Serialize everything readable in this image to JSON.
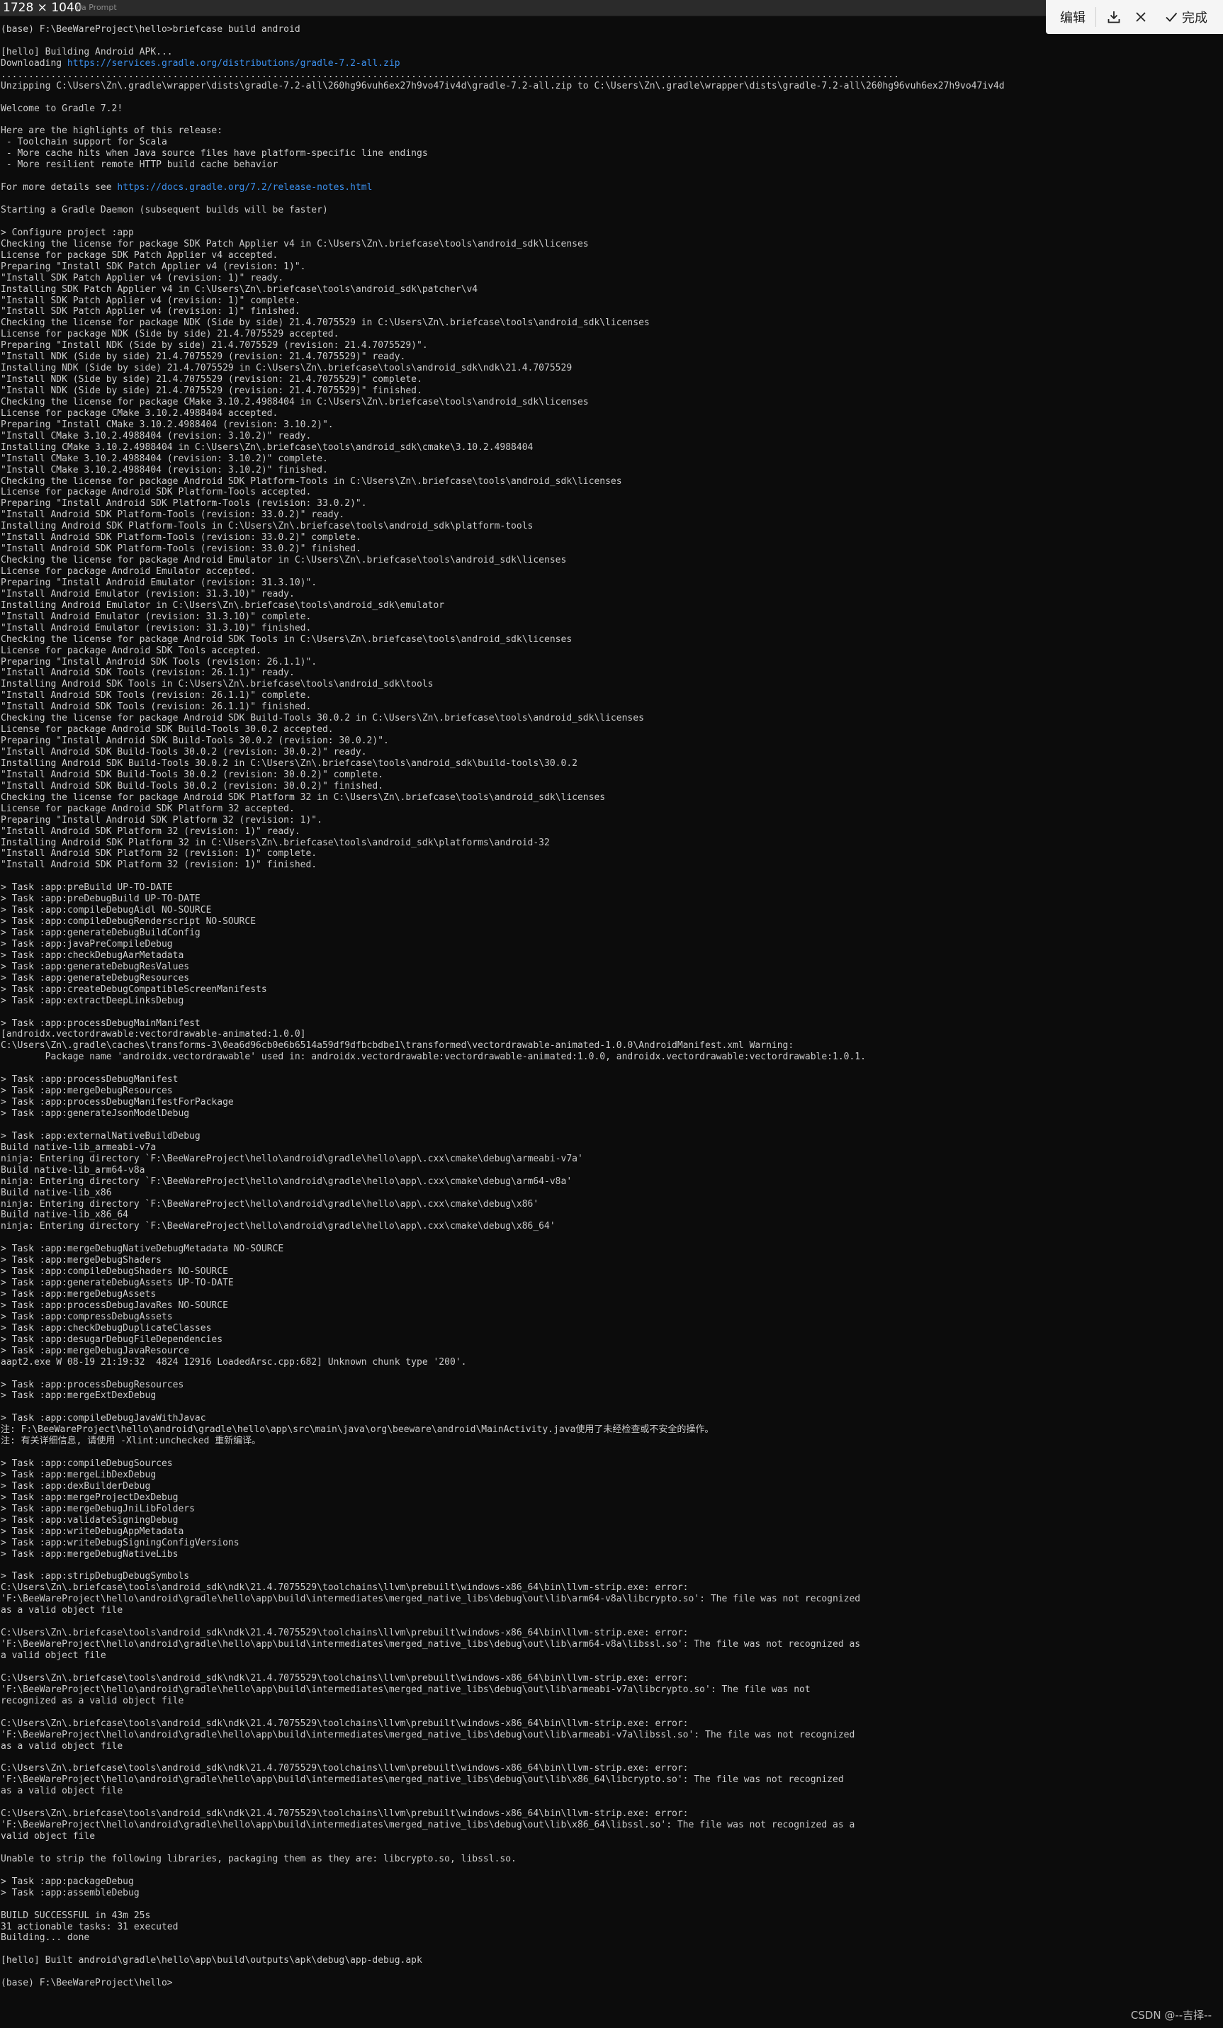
{
  "titlebar": {
    "dimensions": "1728 × 1040",
    "window_title": "da Prompt"
  },
  "toolbar": {
    "edit_label": "编辑",
    "done_label": "完成",
    "icons": [
      "download-icon",
      "close-icon",
      "check-icon"
    ]
  },
  "watermark": "CSDN @--吉择--",
  "colors": {
    "background": "#0c0c0c",
    "text": "#cccccc",
    "link": "#3b8eea"
  },
  "terminal": {
    "lines": [
      {
        "text": "(base) F:\\BeeWareProject\\hello>briefcase build android"
      },
      {
        "text": ""
      },
      {
        "text": "[hello] Building Android APK..."
      },
      {
        "text": "Downloading ",
        "link": "https://services.gradle.org/distributions/gradle-7.2-all.zip"
      },
      {
        "text": ".................................................................................................................................................................."
      },
      {
        "text": "Unzipping C:\\Users\\Zn\\.gradle\\wrapper\\dists\\gradle-7.2-all\\260hg96vuh6ex27h9vo47iv4d\\gradle-7.2-all.zip to C:\\Users\\Zn\\.gradle\\wrapper\\dists\\gradle-7.2-all\\260hg96vuh6ex27h9vo47iv4d"
      },
      {
        "text": ""
      },
      {
        "text": "Welcome to Gradle 7.2!"
      },
      {
        "text": ""
      },
      {
        "text": "Here are the highlights of this release:"
      },
      {
        "text": " - Toolchain support for Scala"
      },
      {
        "text": " - More cache hits when Java source files have platform-specific line endings"
      },
      {
        "text": " - More resilient remote HTTP build cache behavior"
      },
      {
        "text": ""
      },
      {
        "text": "For more details see ",
        "link": "https://docs.gradle.org/7.2/release-notes.html"
      },
      {
        "text": ""
      },
      {
        "text": "Starting a Gradle Daemon (subsequent builds will be faster)"
      },
      {
        "text": ""
      },
      {
        "text": "> Configure project :app"
      },
      {
        "text": "Checking the license for package SDK Patch Applier v4 in C:\\Users\\Zn\\.briefcase\\tools\\android_sdk\\licenses"
      },
      {
        "text": "License for package SDK Patch Applier v4 accepted."
      },
      {
        "text": "Preparing \"Install SDK Patch Applier v4 (revision: 1)\"."
      },
      {
        "text": "\"Install SDK Patch Applier v4 (revision: 1)\" ready."
      },
      {
        "text": "Installing SDK Patch Applier v4 in C:\\Users\\Zn\\.briefcase\\tools\\android_sdk\\patcher\\v4"
      },
      {
        "text": "\"Install SDK Patch Applier v4 (revision: 1)\" complete."
      },
      {
        "text": "\"Install SDK Patch Applier v4 (revision: 1)\" finished."
      },
      {
        "text": "Checking the license for package NDK (Side by side) 21.4.7075529 in C:\\Users\\Zn\\.briefcase\\tools\\android_sdk\\licenses"
      },
      {
        "text": "License for package NDK (Side by side) 21.4.7075529 accepted."
      },
      {
        "text": "Preparing \"Install NDK (Side by side) 21.4.7075529 (revision: 21.4.7075529)\"."
      },
      {
        "text": "\"Install NDK (Side by side) 21.4.7075529 (revision: 21.4.7075529)\" ready."
      },
      {
        "text": "Installing NDK (Side by side) 21.4.7075529 in C:\\Users\\Zn\\.briefcase\\tools\\android_sdk\\ndk\\21.4.7075529"
      },
      {
        "text": "\"Install NDK (Side by side) 21.4.7075529 (revision: 21.4.7075529)\" complete."
      },
      {
        "text": "\"Install NDK (Side by side) 21.4.7075529 (revision: 21.4.7075529)\" finished."
      },
      {
        "text": "Checking the license for package CMake 3.10.2.4988404 in C:\\Users\\Zn\\.briefcase\\tools\\android_sdk\\licenses"
      },
      {
        "text": "License for package CMake 3.10.2.4988404 accepted."
      },
      {
        "text": "Preparing \"Install CMake 3.10.2.4988404 (revision: 3.10.2)\"."
      },
      {
        "text": "\"Install CMake 3.10.2.4988404 (revision: 3.10.2)\" ready."
      },
      {
        "text": "Installing CMake 3.10.2.4988404 in C:\\Users\\Zn\\.briefcase\\tools\\android_sdk\\cmake\\3.10.2.4988404"
      },
      {
        "text": "\"Install CMake 3.10.2.4988404 (revision: 3.10.2)\" complete."
      },
      {
        "text": "\"Install CMake 3.10.2.4988404 (revision: 3.10.2)\" finished."
      },
      {
        "text": "Checking the license for package Android SDK Platform-Tools in C:\\Users\\Zn\\.briefcase\\tools\\android_sdk\\licenses"
      },
      {
        "text": "License for package Android SDK Platform-Tools accepted."
      },
      {
        "text": "Preparing \"Install Android SDK Platform-Tools (revision: 33.0.2)\"."
      },
      {
        "text": "\"Install Android SDK Platform-Tools (revision: 33.0.2)\" ready."
      },
      {
        "text": "Installing Android SDK Platform-Tools in C:\\Users\\Zn\\.briefcase\\tools\\android_sdk\\platform-tools"
      },
      {
        "text": "\"Install Android SDK Platform-Tools (revision: 33.0.2)\" complete."
      },
      {
        "text": "\"Install Android SDK Platform-Tools (revision: 33.0.2)\" finished."
      },
      {
        "text": "Checking the license for package Android Emulator in C:\\Users\\Zn\\.briefcase\\tools\\android_sdk\\licenses"
      },
      {
        "text": "License for package Android Emulator accepted."
      },
      {
        "text": "Preparing \"Install Android Emulator (revision: 31.3.10)\"."
      },
      {
        "text": "\"Install Android Emulator (revision: 31.3.10)\" ready."
      },
      {
        "text": "Installing Android Emulator in C:\\Users\\Zn\\.briefcase\\tools\\android_sdk\\emulator"
      },
      {
        "text": "\"Install Android Emulator (revision: 31.3.10)\" complete."
      },
      {
        "text": "\"Install Android Emulator (revision: 31.3.10)\" finished."
      },
      {
        "text": "Checking the license for package Android SDK Tools in C:\\Users\\Zn\\.briefcase\\tools\\android_sdk\\licenses"
      },
      {
        "text": "License for package Android SDK Tools accepted."
      },
      {
        "text": "Preparing \"Install Android SDK Tools (revision: 26.1.1)\"."
      },
      {
        "text": "\"Install Android SDK Tools (revision: 26.1.1)\" ready."
      },
      {
        "text": "Installing Android SDK Tools in C:\\Users\\Zn\\.briefcase\\tools\\android_sdk\\tools"
      },
      {
        "text": "\"Install Android SDK Tools (revision: 26.1.1)\" complete."
      },
      {
        "text": "\"Install Android SDK Tools (revision: 26.1.1)\" finished."
      },
      {
        "text": "Checking the license for package Android SDK Build-Tools 30.0.2 in C:\\Users\\Zn\\.briefcase\\tools\\android_sdk\\licenses"
      },
      {
        "text": "License for package Android SDK Build-Tools 30.0.2 accepted."
      },
      {
        "text": "Preparing \"Install Android SDK Build-Tools 30.0.2 (revision: 30.0.2)\"."
      },
      {
        "text": "\"Install Android SDK Build-Tools 30.0.2 (revision: 30.0.2)\" ready."
      },
      {
        "text": "Installing Android SDK Build-Tools 30.0.2 in C:\\Users\\Zn\\.briefcase\\tools\\android_sdk\\build-tools\\30.0.2"
      },
      {
        "text": "\"Install Android SDK Build-Tools 30.0.2 (revision: 30.0.2)\" complete."
      },
      {
        "text": "\"Install Android SDK Build-Tools 30.0.2 (revision: 30.0.2)\" finished."
      },
      {
        "text": "Checking the license for package Android SDK Platform 32 in C:\\Users\\Zn\\.briefcase\\tools\\android_sdk\\licenses"
      },
      {
        "text": "License for package Android SDK Platform 32 accepted."
      },
      {
        "text": "Preparing \"Install Android SDK Platform 32 (revision: 1)\"."
      },
      {
        "text": "\"Install Android SDK Platform 32 (revision: 1)\" ready."
      },
      {
        "text": "Installing Android SDK Platform 32 in C:\\Users\\Zn\\.briefcase\\tools\\android_sdk\\platforms\\android-32"
      },
      {
        "text": "\"Install Android SDK Platform 32 (revision: 1)\" complete."
      },
      {
        "text": "\"Install Android SDK Platform 32 (revision: 1)\" finished."
      },
      {
        "text": ""
      },
      {
        "text": "> Task :app:preBuild UP-TO-DATE"
      },
      {
        "text": "> Task :app:preDebugBuild UP-TO-DATE"
      },
      {
        "text": "> Task :app:compileDebugAidl NO-SOURCE"
      },
      {
        "text": "> Task :app:compileDebugRenderscript NO-SOURCE"
      },
      {
        "text": "> Task :app:generateDebugBuildConfig"
      },
      {
        "text": "> Task :app:javaPreCompileDebug"
      },
      {
        "text": "> Task :app:checkDebugAarMetadata"
      },
      {
        "text": "> Task :app:generateDebugResValues"
      },
      {
        "text": "> Task :app:generateDebugResources"
      },
      {
        "text": "> Task :app:createDebugCompatibleScreenManifests"
      },
      {
        "text": "> Task :app:extractDeepLinksDebug"
      },
      {
        "text": ""
      },
      {
        "text": "> Task :app:processDebugMainManifest"
      },
      {
        "text": "[androidx.vectordrawable:vectordrawable-animated:1.0.0]"
      },
      {
        "text": "C:\\Users\\Zn\\.gradle\\caches\\transforms-3\\0ea6d96cb0e6b6514a59df9dfbcbdbe1\\transformed\\vectordrawable-animated-1.0.0\\AndroidManifest.xml Warning:"
      },
      {
        "text": "        Package name 'androidx.vectordrawable' used in: androidx.vectordrawable:vectordrawable-animated:1.0.0, androidx.vectordrawable:vectordrawable:1.0.1."
      },
      {
        "text": ""
      },
      {
        "text": "> Task :app:processDebugManifest"
      },
      {
        "text": "> Task :app:mergeDebugResources"
      },
      {
        "text": "> Task :app:processDebugManifestForPackage"
      },
      {
        "text": "> Task :app:generateJsonModelDebug"
      },
      {
        "text": ""
      },
      {
        "text": "> Task :app:externalNativeBuildDebug"
      },
      {
        "text": "Build native-lib_armeabi-v7a"
      },
      {
        "text": "ninja: Entering directory `F:\\BeeWareProject\\hello\\android\\gradle\\hello\\app\\.cxx\\cmake\\debug\\armeabi-v7a'"
      },
      {
        "text": "Build native-lib_arm64-v8a"
      },
      {
        "text": "ninja: Entering directory `F:\\BeeWareProject\\hello\\android\\gradle\\hello\\app\\.cxx\\cmake\\debug\\arm64-v8a'"
      },
      {
        "text": "Build native-lib_x86"
      },
      {
        "text": "ninja: Entering directory `F:\\BeeWareProject\\hello\\android\\gradle\\hello\\app\\.cxx\\cmake\\debug\\x86'"
      },
      {
        "text": "Build native-lib_x86_64"
      },
      {
        "text": "ninja: Entering directory `F:\\BeeWareProject\\hello\\android\\gradle\\hello\\app\\.cxx\\cmake\\debug\\x86_64'"
      },
      {
        "text": ""
      },
      {
        "text": "> Task :app:mergeDebugNativeDebugMetadata NO-SOURCE"
      },
      {
        "text": "> Task :app:mergeDebugShaders"
      },
      {
        "text": "> Task :app:compileDebugShaders NO-SOURCE"
      },
      {
        "text": "> Task :app:generateDebugAssets UP-TO-DATE"
      },
      {
        "text": "> Task :app:mergeDebugAssets"
      },
      {
        "text": "> Task :app:processDebugJavaRes NO-SOURCE"
      },
      {
        "text": "> Task :app:compressDebugAssets"
      },
      {
        "text": "> Task :app:checkDebugDuplicateClasses"
      },
      {
        "text": "> Task :app:desugarDebugFileDependencies"
      },
      {
        "text": "> Task :app:mergeDebugJavaResource"
      },
      {
        "text": "aapt2.exe W 08-19 21:19:32  4824 12916 LoadedArsc.cpp:682] Unknown chunk type '200'."
      },
      {
        "text": ""
      },
      {
        "text": "> Task :app:processDebugResources"
      },
      {
        "text": "> Task :app:mergeExtDexDebug"
      },
      {
        "text": ""
      },
      {
        "text": "> Task :app:compileDebugJavaWithJavac"
      },
      {
        "text": "注: F:\\BeeWareProject\\hello\\android\\gradle\\hello\\app\\src\\main\\java\\org\\beeware\\android\\MainActivity.java使用了未经检查或不安全的操作。"
      },
      {
        "text": "注: 有关详细信息, 请使用 -Xlint:unchecked 重新编译。"
      },
      {
        "text": ""
      },
      {
        "text": "> Task :app:compileDebugSources"
      },
      {
        "text": "> Task :app:mergeLibDexDebug"
      },
      {
        "text": "> Task :app:dexBuilderDebug"
      },
      {
        "text": "> Task :app:mergeProjectDexDebug"
      },
      {
        "text": "> Task :app:mergeDebugJniLibFolders"
      },
      {
        "text": "> Task :app:validateSigningDebug"
      },
      {
        "text": "> Task :app:writeDebugAppMetadata"
      },
      {
        "text": "> Task :app:writeDebugSigningConfigVersions"
      },
      {
        "text": "> Task :app:mergeDebugNativeLibs"
      },
      {
        "text": ""
      },
      {
        "text": "> Task :app:stripDebugDebugSymbols"
      },
      {
        "text": "C:\\Users\\Zn\\.briefcase\\tools\\android_sdk\\ndk\\21.4.7075529\\toolchains\\llvm\\prebuilt\\windows-x86_64\\bin\\llvm-strip.exe: error:"
      },
      {
        "text": "'F:\\BeeWareProject\\hello\\android\\gradle\\hello\\app\\build\\intermediates\\merged_native_libs\\debug\\out\\lib\\arm64-v8a\\libcrypto.so': The file was not recognized"
      },
      {
        "text": "as a valid object file"
      },
      {
        "text": ""
      },
      {
        "text": "C:\\Users\\Zn\\.briefcase\\tools\\android_sdk\\ndk\\21.4.7075529\\toolchains\\llvm\\prebuilt\\windows-x86_64\\bin\\llvm-strip.exe: error:"
      },
      {
        "text": "'F:\\BeeWareProject\\hello\\android\\gradle\\hello\\app\\build\\intermediates\\merged_native_libs\\debug\\out\\lib\\arm64-v8a\\libssl.so': The file was not recognized as"
      },
      {
        "text": "a valid object file"
      },
      {
        "text": ""
      },
      {
        "text": "C:\\Users\\Zn\\.briefcase\\tools\\android_sdk\\ndk\\21.4.7075529\\toolchains\\llvm\\prebuilt\\windows-x86_64\\bin\\llvm-strip.exe: error:"
      },
      {
        "text": "'F:\\BeeWareProject\\hello\\android\\gradle\\hello\\app\\build\\intermediates\\merged_native_libs\\debug\\out\\lib\\armeabi-v7a\\libcrypto.so': The file was not"
      },
      {
        "text": "recognized as a valid object file"
      },
      {
        "text": ""
      },
      {
        "text": "C:\\Users\\Zn\\.briefcase\\tools\\android_sdk\\ndk\\21.4.7075529\\toolchains\\llvm\\prebuilt\\windows-x86_64\\bin\\llvm-strip.exe: error:"
      },
      {
        "text": "'F:\\BeeWareProject\\hello\\android\\gradle\\hello\\app\\build\\intermediates\\merged_native_libs\\debug\\out\\lib\\armeabi-v7a\\libssl.so': The file was not recognized"
      },
      {
        "text": "as a valid object file"
      },
      {
        "text": ""
      },
      {
        "text": "C:\\Users\\Zn\\.briefcase\\tools\\android_sdk\\ndk\\21.4.7075529\\toolchains\\llvm\\prebuilt\\windows-x86_64\\bin\\llvm-strip.exe: error:"
      },
      {
        "text": "'F:\\BeeWareProject\\hello\\android\\gradle\\hello\\app\\build\\intermediates\\merged_native_libs\\debug\\out\\lib\\x86_64\\libcrypto.so': The file was not recognized"
      },
      {
        "text": "as a valid object file"
      },
      {
        "text": ""
      },
      {
        "text": "C:\\Users\\Zn\\.briefcase\\tools\\android_sdk\\ndk\\21.4.7075529\\toolchains\\llvm\\prebuilt\\windows-x86_64\\bin\\llvm-strip.exe: error:"
      },
      {
        "text": "'F:\\BeeWareProject\\hello\\android\\gradle\\hello\\app\\build\\intermediates\\merged_native_libs\\debug\\out\\lib\\x86_64\\libssl.so': The file was not recognized as a"
      },
      {
        "text": "valid object file"
      },
      {
        "text": ""
      },
      {
        "text": "Unable to strip the following libraries, packaging them as they are: libcrypto.so, libssl.so."
      },
      {
        "text": ""
      },
      {
        "text": "> Task :app:packageDebug"
      },
      {
        "text": "> Task :app:assembleDebug"
      },
      {
        "text": ""
      },
      {
        "text": "BUILD SUCCESSFUL in 43m 25s"
      },
      {
        "text": "31 actionable tasks: 31 executed"
      },
      {
        "text": "Building... done"
      },
      {
        "text": ""
      },
      {
        "text": "[hello] Built android\\gradle\\hello\\app\\build\\outputs\\apk\\debug\\app-debug.apk"
      },
      {
        "text": ""
      },
      {
        "text": "(base) F:\\BeeWareProject\\hello>"
      }
    ]
  }
}
